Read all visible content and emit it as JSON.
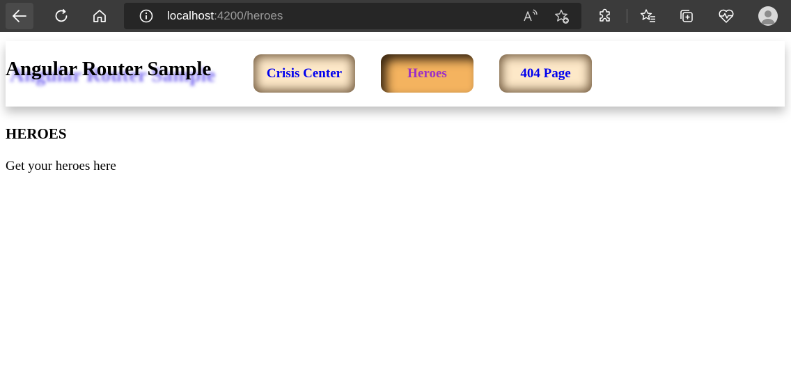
{
  "browser": {
    "url_host": "localhost",
    "url_path": ":4200/heroes",
    "icons": [
      "back-icon",
      "refresh-icon",
      "home-icon",
      "site-info-icon",
      "read-aloud-icon",
      "add-favorite-icon",
      "extensions-icon",
      "favorites-icon",
      "collections-icon",
      "performance-icon",
      "profile-icon"
    ]
  },
  "header": {
    "title": "Angular Router Sample",
    "nav": [
      {
        "label": "Crisis Center",
        "active": false
      },
      {
        "label": "Heroes",
        "active": true
      },
      {
        "label": "404 Page",
        "active": false
      }
    ]
  },
  "main": {
    "heading": "HEROES",
    "text": "Get your heroes here"
  },
  "colors": {
    "link": "#0000ee",
    "active_link": "#9b30c6",
    "button_bg": "#fde8c8",
    "active_button_bg": "#f4b35f",
    "title_shadow": "#7b6cf0"
  }
}
